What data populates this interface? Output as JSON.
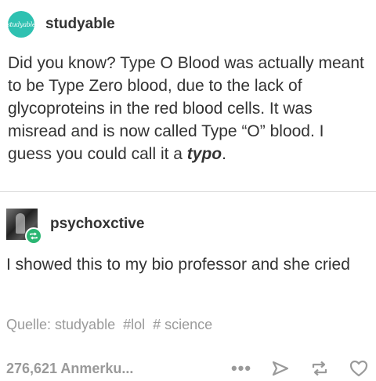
{
  "post": {
    "author1": {
      "name": "studyable",
      "avatar_text": "studyable"
    },
    "body1": {
      "text_before": "Did you know? Type O Blood was actually meant to be Type Zero blood, due to the lack of glycoproteins in the red blood cells. It was misread and is now called Type “O” blood. I guess you could call it a ",
      "emphasis": "typo",
      "text_after": "."
    },
    "author2": {
      "name": "psychoxctive"
    },
    "body2": {
      "text": "I showed this to my bio professor and she cried"
    },
    "source": {
      "label": "Quelle: studyable",
      "tags": [
        "#lol",
        "# science"
      ]
    },
    "footer": {
      "notes": "276,621 Anmerku...",
      "icons": [
        "more-icon",
        "share-icon",
        "reblog-icon",
        "like-icon"
      ]
    }
  },
  "colors": {
    "text": "#333333",
    "muted": "#9a9a9a",
    "avatar_teal": "#2fc1b1",
    "reblog_green": "#2bb673"
  }
}
